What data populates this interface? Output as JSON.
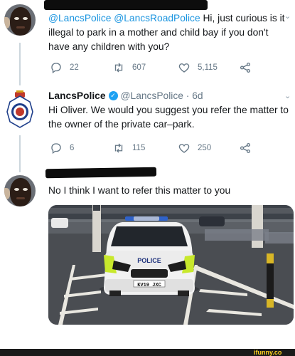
{
  "tweet1": {
    "text_mentions": "@LancsPolice @LancsRoadPolice",
    "text_body": " Hi, just curious is it illegal to park in a mother and child bay if you don't have any children with you?",
    "replies": "22",
    "retweets": "607",
    "likes": "5,115"
  },
  "tweet2": {
    "name": "LancsPolice",
    "handle": "@LancsPolice · 6d",
    "text": "Hi Oliver. We would you suggest you refer the matter to the owner of the private car–park.",
    "replies": "6",
    "retweets": "115",
    "likes": "250"
  },
  "tweet3": {
    "text": "No I think I want to refer this matter to you"
  },
  "photo": {
    "bonnet_text": "POLICE",
    "plate_text": "KV19 JXC"
  },
  "icons": {
    "reply": "reply-icon",
    "retweet": "retweet-icon",
    "like": "heart-icon",
    "share": "share-icon",
    "menu": "chevron-down-icon"
  },
  "colors": {
    "link_blue": "#1b95e0",
    "verified_blue": "#1da1f2",
    "muted_gray": "#657786",
    "watermark_yellow": "#ffd21f"
  },
  "watermark": "ifunny.co"
}
